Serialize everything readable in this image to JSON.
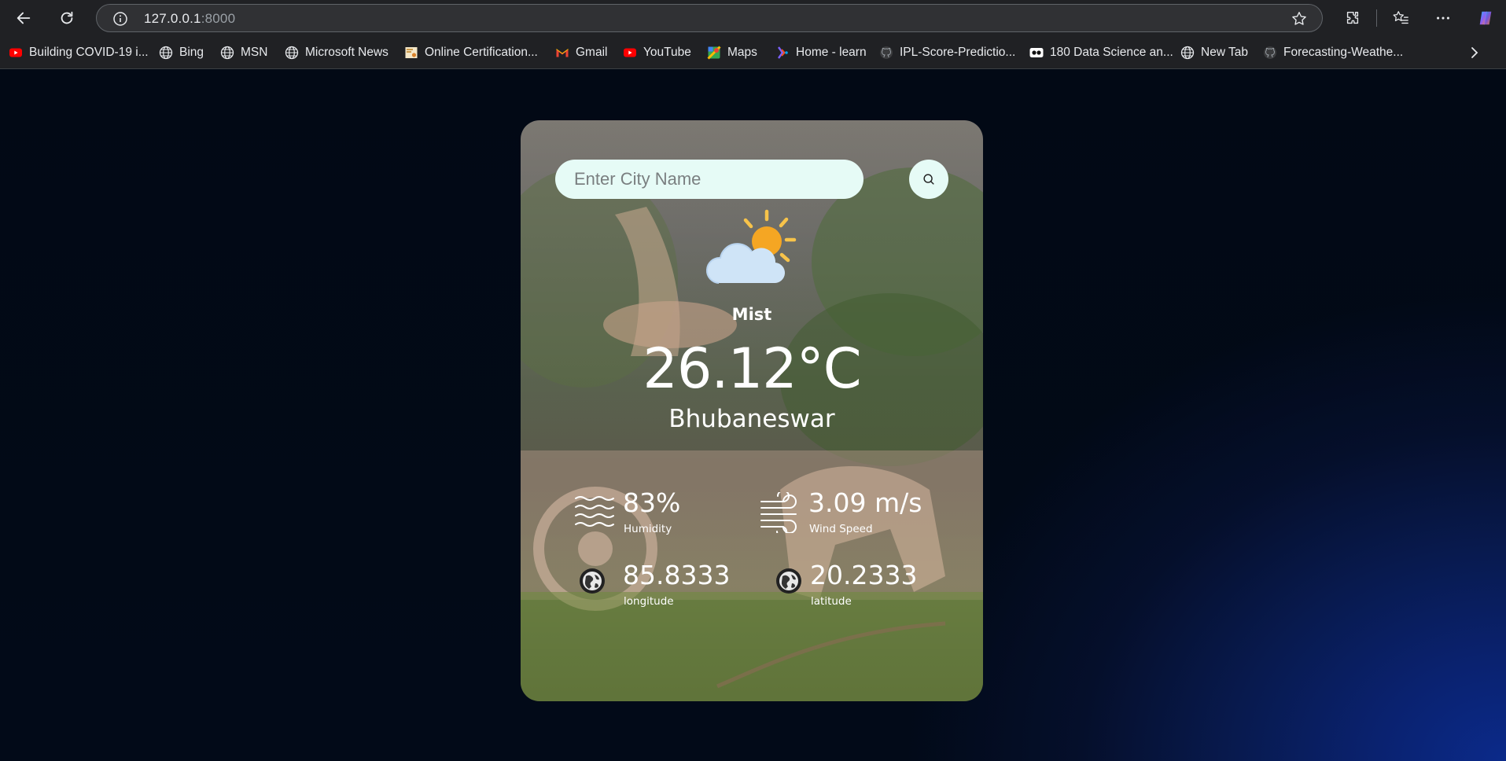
{
  "browser": {
    "url_host": "127.0.0.1",
    "url_port": ":8000",
    "bookmarks": [
      {
        "label": "Building COVID-19 i...",
        "icon": "youtube-icon"
      },
      {
        "label": "Bing",
        "icon": "globe-icon"
      },
      {
        "label": "MSN",
        "icon": "globe-icon"
      },
      {
        "label": "Microsoft News",
        "icon": "globe-icon"
      },
      {
        "label": "Online Certification...",
        "icon": "certificate-icon"
      },
      {
        "label": "Gmail",
        "icon": "gmail-icon"
      },
      {
        "label": "YouTube",
        "icon": "youtube-icon"
      },
      {
        "label": "Maps",
        "icon": "maps-icon"
      },
      {
        "label": "Home - learn",
        "icon": "learn-icon"
      },
      {
        "label": "IPL-Score-Predictio...",
        "icon": "github-icon"
      },
      {
        "label": "180 Data Science an...",
        "icon": "camera-icon"
      },
      {
        "label": "New Tab",
        "icon": "globe-icon"
      },
      {
        "label": "Forecasting-Weathe...",
        "icon": "github-icon"
      }
    ]
  },
  "weather": {
    "search_placeholder": "Enter City Name",
    "condition": "Mist",
    "temperature": "26.12°C",
    "city": "Bhubaneswar",
    "humidity_value": "83%",
    "humidity_label": "Humidity",
    "wind_value": "3.09 m/s",
    "wind_label": "Wind Speed",
    "longitude_value": "85.8333",
    "longitude_label": "longitude",
    "latitude_value": "20.2333",
    "latitude_label": "latitude"
  },
  "colors": {
    "input_bg": "#e6fbf6",
    "page_bg": "#020915",
    "accent_blue": "#0b2a8a"
  }
}
